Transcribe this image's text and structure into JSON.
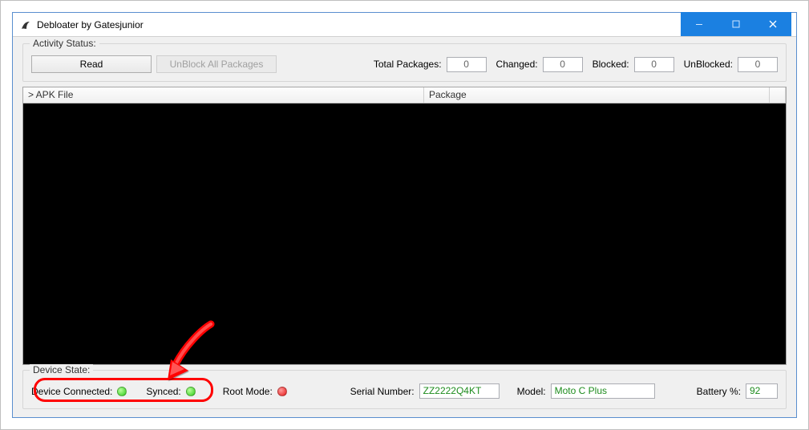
{
  "titlebar": {
    "title": "Debloater by Gatesjunior"
  },
  "activity": {
    "legend": "Activity Status:",
    "read_button": "Read",
    "unblock_button": "UnBlock All Packages",
    "total_label": "Total Packages:",
    "total_value": "0",
    "changed_label": "Changed:",
    "changed_value": "0",
    "blocked_label": "Blocked:",
    "blocked_value": "0",
    "unblocked_label": "UnBlocked:",
    "unblocked_value": "0"
  },
  "table": {
    "col_apk": "> APK File",
    "col_pkg": "Package"
  },
  "device": {
    "legend": "Device State:",
    "connected_label": "Device Connected:",
    "synced_label": "Synced:",
    "root_label": "Root Mode:",
    "serial_label": "Serial Number:",
    "serial_value": "ZZ2222Q4KT",
    "model_label": "Model:",
    "model_value": "Moto C Plus",
    "battery_label": "Battery %:",
    "battery_value": "92"
  }
}
